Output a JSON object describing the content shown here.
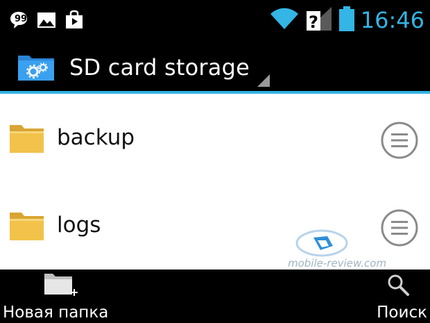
{
  "status_bar": {
    "time": "16:46",
    "icons": [
      "chat-icon",
      "picture-icon",
      "shopping-bag-icon",
      "wifi-icon",
      "signal-unknown-icon",
      "battery-icon"
    ]
  },
  "action_bar": {
    "title": "SD card storage",
    "app_icon": "folder-settings-icon"
  },
  "files": [
    {
      "name": "backup",
      "icon": "folder-icon"
    },
    {
      "name": "logs",
      "icon": "folder-icon"
    }
  ],
  "watermark": {
    "text": "mobile-review.com"
  },
  "bottom_bar": {
    "new_folder_label": "Новая папка",
    "search_label": "Поиск"
  },
  "colors": {
    "accent": "#33b5e5",
    "bar_background": "#000000",
    "list_background": "#ffffff",
    "folder": "#f2c24a"
  }
}
